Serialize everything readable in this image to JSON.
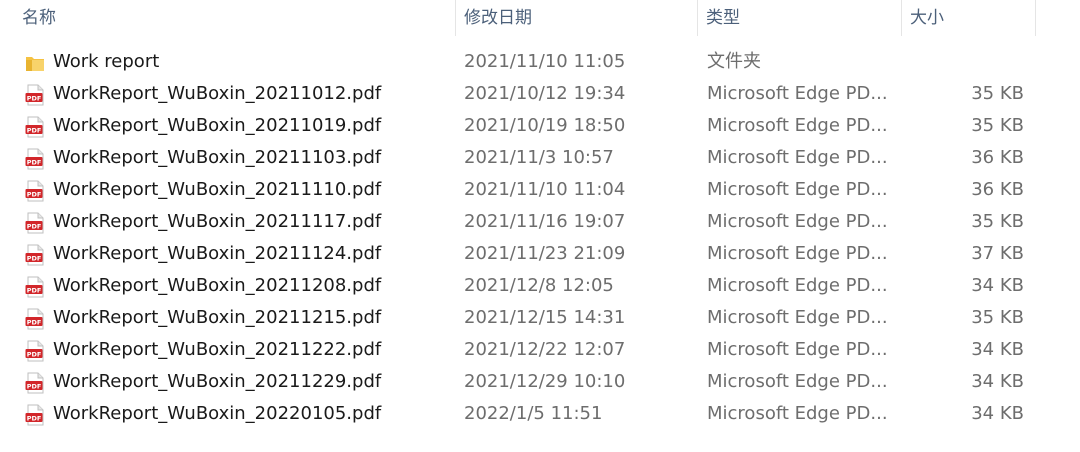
{
  "columns": {
    "name": "名称",
    "date_modified": "修改日期",
    "type": "类型",
    "size": "大小"
  },
  "colors": {
    "folder": "#f5c242",
    "pdf_red": "#d2262a",
    "header_text": "#4c607a",
    "secondary_text": "#6d6d6d"
  },
  "files": [
    {
      "name": "Work report",
      "date": "2021/11/10 11:05",
      "type": "文件夹",
      "size": "",
      "icon": "folder-icon"
    },
    {
      "name": "WorkReport_WuBoxin_20211012.pdf",
      "date": "2021/10/12 19:34",
      "type": "Microsoft Edge PD...",
      "size": "35 KB",
      "icon": "pdf-icon"
    },
    {
      "name": "WorkReport_WuBoxin_20211019.pdf",
      "date": "2021/10/19 18:50",
      "type": "Microsoft Edge PD...",
      "size": "35 KB",
      "icon": "pdf-icon"
    },
    {
      "name": "WorkReport_WuBoxin_20211103.pdf",
      "date": "2021/11/3 10:57",
      "type": "Microsoft Edge PD...",
      "size": "36 KB",
      "icon": "pdf-icon"
    },
    {
      "name": "WorkReport_WuBoxin_20211110.pdf",
      "date": "2021/11/10 11:04",
      "type": "Microsoft Edge PD...",
      "size": "36 KB",
      "icon": "pdf-icon"
    },
    {
      "name": "WorkReport_WuBoxin_20211117.pdf",
      "date": "2021/11/16 19:07",
      "type": "Microsoft Edge PD...",
      "size": "35 KB",
      "icon": "pdf-icon"
    },
    {
      "name": "WorkReport_WuBoxin_20211124.pdf",
      "date": "2021/11/23 21:09",
      "type": "Microsoft Edge PD...",
      "size": "37 KB",
      "icon": "pdf-icon"
    },
    {
      "name": "WorkReport_WuBoxin_20211208.pdf",
      "date": "2021/12/8 12:05",
      "type": "Microsoft Edge PD...",
      "size": "34 KB",
      "icon": "pdf-icon"
    },
    {
      "name": "WorkReport_WuBoxin_20211215.pdf",
      "date": "2021/12/15 14:31",
      "type": "Microsoft Edge PD...",
      "size": "35 KB",
      "icon": "pdf-icon"
    },
    {
      "name": "WorkReport_WuBoxin_20211222.pdf",
      "date": "2021/12/22 12:07",
      "type": "Microsoft Edge PD...",
      "size": "34 KB",
      "icon": "pdf-icon"
    },
    {
      "name": "WorkReport_WuBoxin_20211229.pdf",
      "date": "2021/12/29 10:10",
      "type": "Microsoft Edge PD...",
      "size": "34 KB",
      "icon": "pdf-icon"
    },
    {
      "name": "WorkReport_WuBoxin_20220105.pdf",
      "date": "2022/1/5 11:51",
      "type": "Microsoft Edge PD...",
      "size": "34 KB",
      "icon": "pdf-icon"
    }
  ]
}
